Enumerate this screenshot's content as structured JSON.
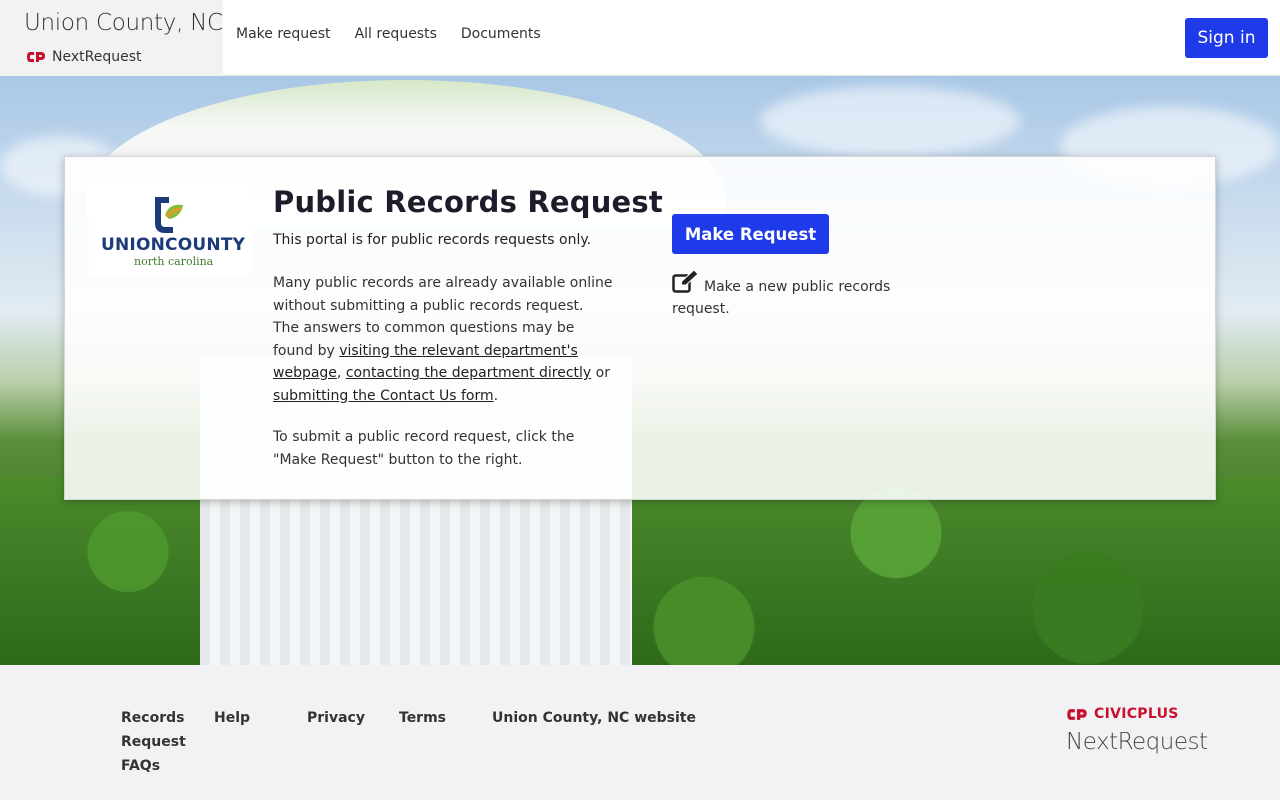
{
  "header": {
    "org_title": "Union County, NC",
    "brand_name": "NextRequest",
    "nav": [
      "Make request",
      "All requests",
      "Documents"
    ],
    "signin_label": "Sign in"
  },
  "colors": {
    "primary": "#1f3ae8",
    "civicplus_red": "#c8102e",
    "county_blue": "#1d3a7a",
    "county_green": "#3f7d2f"
  },
  "card": {
    "logo": {
      "main_union": "UNION",
      "main_county": "COUNTY",
      "sub": "north carolina"
    },
    "title": "Public Records Request",
    "lead": "This portal is for public records requests only.",
    "body": {
      "text1": "Many public records are already available online without submitting a public records request. The answers to common questions may be found by ",
      "link1": "visiting the relevant department's webpage",
      "sep1": ", ",
      "link2": "contacting the department directly",
      "sep2": " or ",
      "link3": "submitting the Contact Us form",
      "end": "."
    },
    "paragraph2": "To submit a public record request, click the \"Make Request\" button to the right.",
    "make_request_label": "Make Request",
    "make_request_desc": "Make a new public records request."
  },
  "footer": {
    "links": {
      "records_faqs": "Records Request FAQs",
      "help": "Help",
      "privacy": "Privacy",
      "terms": "Terms",
      "website": "Union County, NC website"
    },
    "civicplus": "CIVICPLUS",
    "nextrequest": "NextRequest"
  }
}
